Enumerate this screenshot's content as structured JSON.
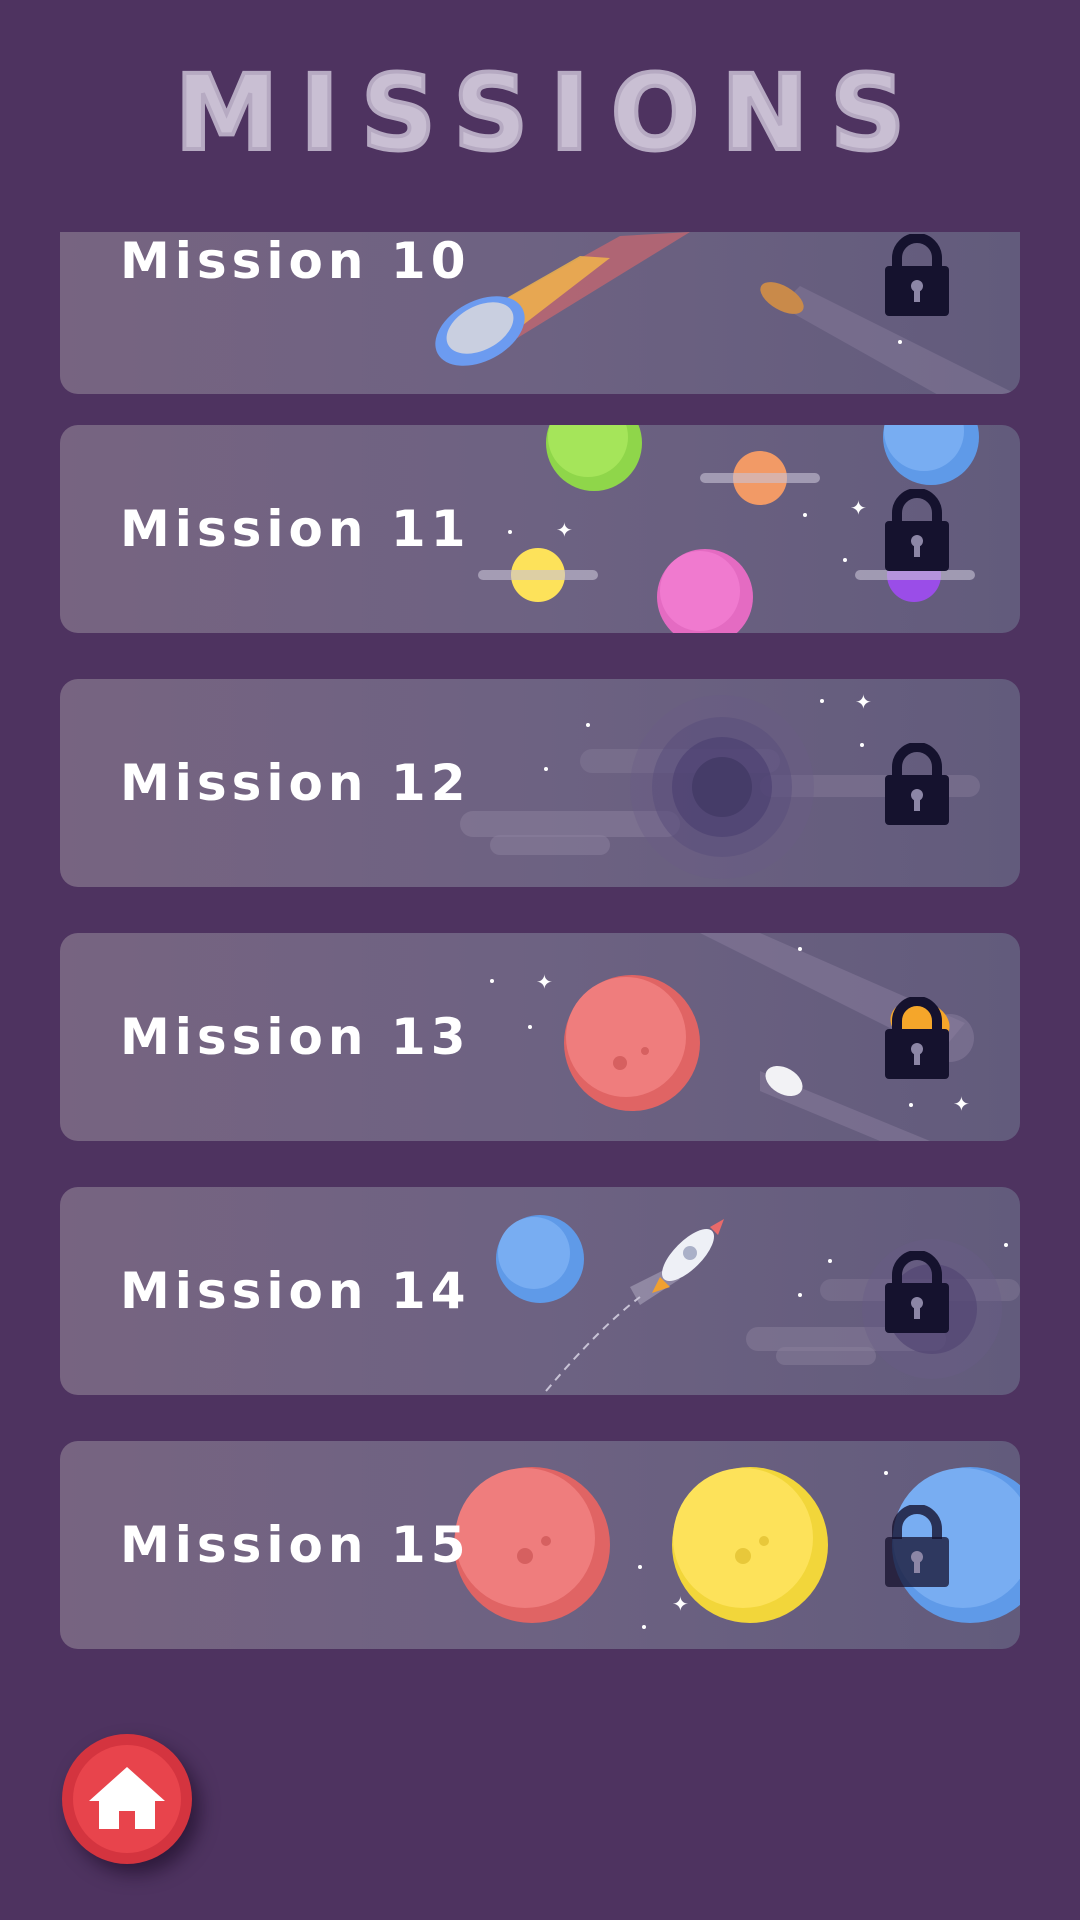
{
  "screen": {
    "title": "MISSIONS"
  },
  "missions": [
    {
      "label": "Mission 10",
      "locked": true,
      "theme": "comets"
    },
    {
      "label": "Mission 11",
      "locked": true,
      "theme": "planets"
    },
    {
      "label": "Mission 12",
      "locked": true,
      "theme": "black-hole"
    },
    {
      "label": "Mission 13",
      "locked": true,
      "theme": "red-planet-meteors"
    },
    {
      "label": "Mission 14",
      "locked": true,
      "theme": "rocket"
    },
    {
      "label": "Mission 15",
      "locked": true,
      "theme": "moons"
    }
  ],
  "home_button": {
    "icon": "home-icon"
  },
  "colors": {
    "background": "#4e3360",
    "card": "#6d6282",
    "title": "#c9bfd3",
    "lock": "#15122e",
    "home": "#e8444c"
  }
}
